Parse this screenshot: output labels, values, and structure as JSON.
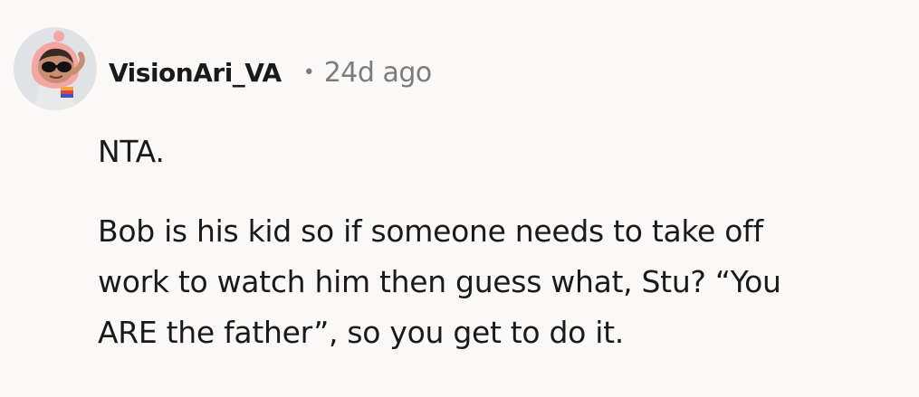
{
  "comment": {
    "author": "VisionAri_VA",
    "separator": "•",
    "timestamp": "24d ago",
    "avatar_icon": "avatar-icon",
    "paragraphs": [
      {
        "lines": [
          "NTA."
        ]
      },
      {
        "lines": [
          "Bob is his kid so if someone needs to take off",
          "work to watch him then guess what, Stu? “You",
          "ARE the father”, so you get to do it."
        ]
      }
    ]
  }
}
